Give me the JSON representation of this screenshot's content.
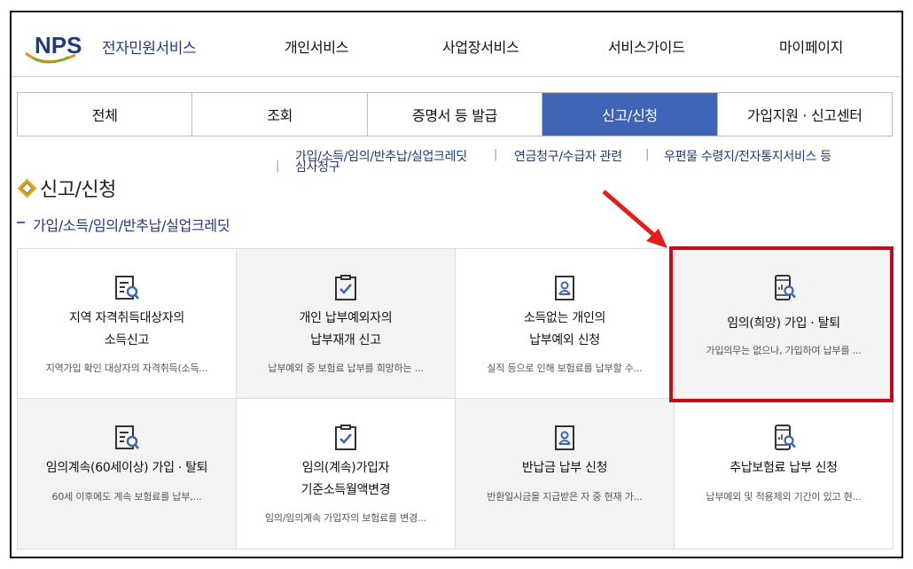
{
  "header": {
    "logo_text": "NPS",
    "logo_title": "전자민원서비스",
    "nav": [
      "개인서비스",
      "사업장서비스",
      "서비스가이드",
      "마이페이지"
    ]
  },
  "tabs": [
    {
      "label": "전체",
      "active": false
    },
    {
      "label": "조회",
      "active": false
    },
    {
      "label": "증명서 등 발급",
      "active": false
    },
    {
      "label": "신고/신청",
      "active": true
    },
    {
      "label": "가입지원 · 신고센터",
      "active": false
    }
  ],
  "subnav": {
    "item1_line1": "가입/소득/임의/반추납/실업크레딧",
    "item1_line2": "심사청구",
    "item2": "연금청구/수급자 관련",
    "item3": "우편물 수령지/전자통지서비스 등"
  },
  "page_title": "신고/신청",
  "section_title": "가입/소득/임의/반추납/실업크레딧",
  "cards": [
    {
      "icon": "document-search-icon",
      "title_line1": "지역 자격취득대상자의",
      "title_line2": "소득신고",
      "desc": "지역가입 확인 대상자의 자격취득(소득..."
    },
    {
      "icon": "clipboard-check-icon",
      "title_line1": "개인 납부예외자의",
      "title_line2": "납부재개 신고",
      "desc": "납부예외 중 보험료 납부를 희망하는 ..."
    },
    {
      "icon": "id-card-icon",
      "title_line1": "소득없는 개인의",
      "title_line2": "납부예외 신청",
      "desc": "실직 등으로 인해 보험료를 납부할 수..."
    },
    {
      "icon": "phone-search-icon",
      "title_line1": "임의(희망) 가입 · 탈퇴",
      "title_line2": "",
      "desc": "가입의무는 없으나, 가입하여 납부를 ..."
    },
    {
      "icon": "document-search-icon",
      "title_line1": "임의계속(60세이상) 가입 · 탈퇴",
      "title_line2": "",
      "desc": "60세 이후에도 계속 보험료를 납부,..."
    },
    {
      "icon": "clipboard-check-icon",
      "title_line1": "임의(계속)가입자",
      "title_line2": "기준소득월액변경",
      "desc": "임의/임의계속 가입자의 보험료를 변경..."
    },
    {
      "icon": "id-card-icon",
      "title_line1": "반납금 납부 신청",
      "title_line2": "",
      "desc": "반환일시금을 지급받은 자 중 현재 가..."
    },
    {
      "icon": "phone-search-icon",
      "title_line1": "추납보험료 납부 신청",
      "title_line2": "",
      "desc": "납부예외 및 적용제외 기간이 있고 현..."
    }
  ],
  "colors": {
    "accent": "#3f63b5",
    "highlight": "#b5121b",
    "arrow": "#e0201c"
  }
}
